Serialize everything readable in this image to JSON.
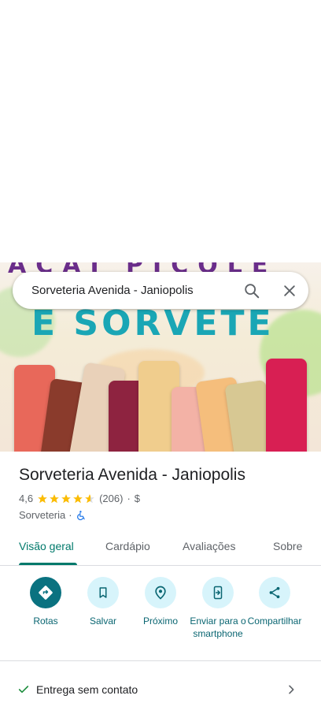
{
  "search": {
    "query": "Sorveteria Avenida - Janiopolis"
  },
  "hero": {
    "banner_top": "AÇAÍ PICOLÉ",
    "banner_main": "E SORVETE"
  },
  "place": {
    "name": "Sorveteria Avenida - Janiopolis",
    "rating": "4,6",
    "stars_value": 4.6,
    "review_count": "(206)",
    "separator": "·",
    "price": "$",
    "category": "Sorveteria",
    "category_separator": "·"
  },
  "tabs": [
    {
      "label": "Visão geral",
      "active": true
    },
    {
      "label": "Cardápio",
      "active": false
    },
    {
      "label": "Avaliações",
      "active": false
    },
    {
      "label": "Sobre",
      "active": false
    }
  ],
  "actions": [
    {
      "label": "Rotas",
      "icon": "directions-icon"
    },
    {
      "label": "Salvar",
      "icon": "bookmark-icon"
    },
    {
      "label": "Próximo",
      "icon": "nearby-icon"
    },
    {
      "label": "Enviar para o smartphone",
      "icon": "send-to-phone-icon"
    },
    {
      "label": "Compartilhar",
      "icon": "share-icon"
    }
  ],
  "features": [
    {
      "label": "Entrega sem contato",
      "icon": "check-icon"
    }
  ],
  "colors": {
    "accent": "#00796b",
    "primary_action": "#0a7280",
    "action_bg": "#d7f4fb",
    "star": "#fbbc04"
  }
}
